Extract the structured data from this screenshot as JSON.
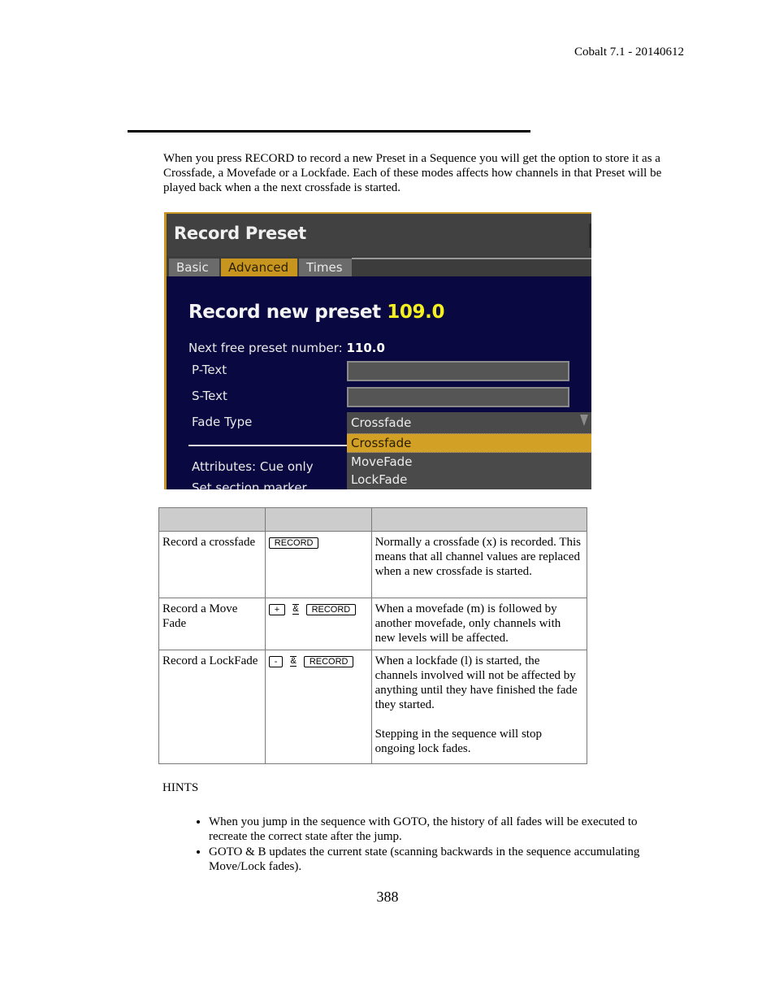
{
  "page_header": "Cobalt 7.1 - 20140612",
  "intro": "When you press RECORD to record a new Preset in a Sequence you will get the option to store it as a Crossfade, a Movefade or a Lockfade. Each of these modes affects how channels in that Preset will be played back when a the next crossfade is started.",
  "dialog": {
    "title": "Record Preset",
    "tabs": [
      {
        "label": "Basic",
        "active": false
      },
      {
        "label": "Advanced",
        "active": true
      },
      {
        "label": "Times",
        "active": false
      }
    ],
    "heading_prefix": "Record new preset",
    "heading_number": "109.0",
    "next_free_label": "Next free preset number:",
    "next_free_value": "110.0",
    "fields": [
      {
        "label": "P-Text",
        "value": ""
      },
      {
        "label": "S-Text",
        "value": ""
      }
    ],
    "fade_type_label": "Fade Type",
    "fade_type_selected": "Crossfade",
    "fade_type_options": [
      "Crossfade",
      "MoveFade",
      "LockFade"
    ],
    "attributes_label": "Attributes: Cue only",
    "section_marker_label": "Set section marker",
    "colors": {
      "accent": "#c8961e",
      "background": "#0a0840",
      "highlight_number": "#f4f020"
    }
  },
  "table": {
    "headers": [
      "",
      "",
      ""
    ],
    "rows": [
      {
        "action": "Record a crossfade",
        "keys": [
          "RECORD"
        ],
        "description": [
          "Normally a crossfade (x) is recorded. This means that all channel values are replaced when a new crossfade is started."
        ]
      },
      {
        "action": "Record a Move Fade",
        "keys": [
          "+",
          "&",
          "RECORD"
        ],
        "description": [
          "When a movefade (m) is followed by another movefade, only channels with new levels will be affected."
        ]
      },
      {
        "action": "Record a LockFade",
        "keys": [
          "-",
          "&",
          "RECORD"
        ],
        "description": [
          "When a lockfade (l) is started, the channels involved will not be affected by anything until they have finished the fade they started.",
          "Stepping in the sequence will stop ongoing lock fades."
        ]
      }
    ]
  },
  "hints": {
    "title": "HINTS",
    "items": [
      "When you jump in the sequence with GOTO, the history of all fades will be executed to recreate the correct state after the jump.",
      "GOTO & B updates the current state (scanning backwards in the sequence accumulating Move/Lock fades)."
    ]
  },
  "page_number": "388"
}
